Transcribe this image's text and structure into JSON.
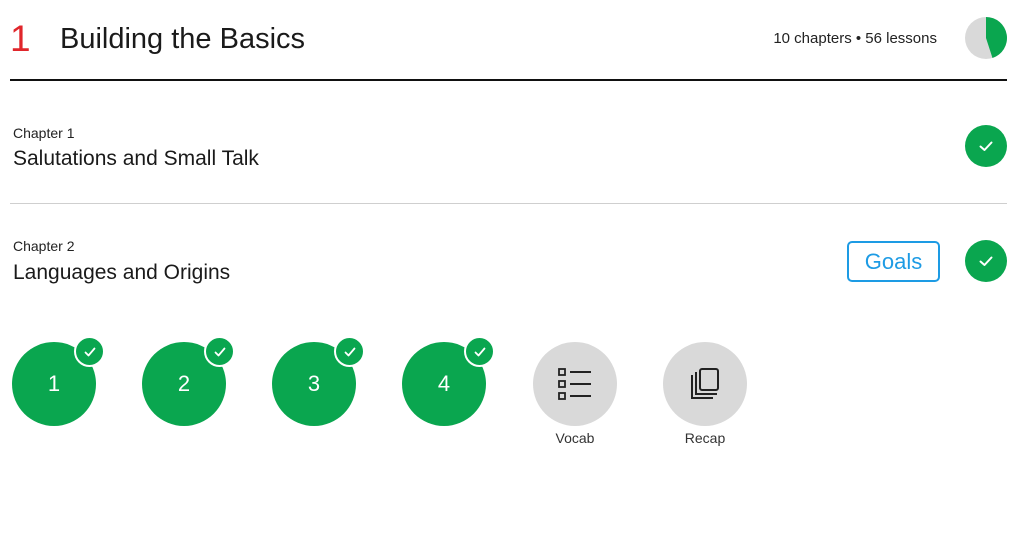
{
  "unit": {
    "number": "1",
    "title": "Building the Basics",
    "meta": "10 chapters • 56 lessons",
    "progress_fraction": 0.45
  },
  "chapters": [
    {
      "label": "Chapter 1",
      "title": "Salutations and Small Talk",
      "completed": true
    },
    {
      "label": "Chapter 2",
      "title": "Languages and Origins",
      "completed": true,
      "goals_label": "Goals"
    }
  ],
  "lessons": [
    {
      "label": "1",
      "completed": true
    },
    {
      "label": "2",
      "completed": true
    },
    {
      "label": "3",
      "completed": true
    },
    {
      "label": "4",
      "completed": true
    }
  ],
  "extras": [
    {
      "label": "Vocab",
      "icon": "list-icon"
    },
    {
      "label": "Recap",
      "icon": "stacked-cards-icon"
    }
  ],
  "colors": {
    "accent_green": "#0aa64f",
    "unit_number_red": "#e0262b",
    "goals_blue": "#1d9be4",
    "inactive_grey": "#d9d9d9"
  }
}
